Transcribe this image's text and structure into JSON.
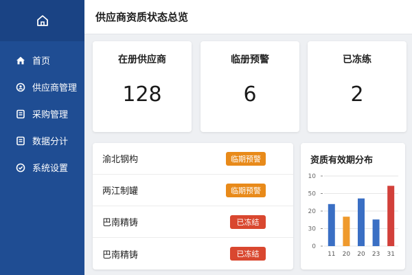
{
  "header": {
    "title": "供应商资质状态总览"
  },
  "sidebar": {
    "logo_icon": "home-outline-icon",
    "items": [
      {
        "label": "首页",
        "icon": "home-icon"
      },
      {
        "label": "供应商管理",
        "icon": "supplier-icon"
      },
      {
        "label": "采购管理",
        "icon": "purchase-list-icon"
      },
      {
        "label": "数据分计",
        "icon": "data-list-icon"
      },
      {
        "label": "系统设置",
        "icon": "settings-icon"
      }
    ]
  },
  "stats": [
    {
      "label": "在册供应商",
      "value": "128"
    },
    {
      "label": "临册预警",
      "value": "6"
    },
    {
      "label": "已冻练",
      "value": "2"
    }
  ],
  "suppliers": [
    {
      "name": "渝北钢构",
      "status": "临期预警",
      "color": "#e88a1a"
    },
    {
      "name": "两江制罐",
      "status": "临期预警",
      "color": "#e88a1a"
    },
    {
      "name": "巴南精铸",
      "status": "已冻结",
      "color": "#d9472f"
    },
    {
      "name": "巴南精铸",
      "status": "已冻结",
      "color": "#d9472f"
    }
  ],
  "colors": {
    "sidebar": "#1f4d93",
    "blue": "#3a6fc4",
    "orange": "#ef9a2d",
    "red": "#d2403a"
  },
  "chart_data": {
    "type": "bar",
    "title": "资质有效期分布",
    "categories": [
      "11",
      "20",
      "20",
      "23",
      "31"
    ],
    "values": [
      30,
      21,
      34,
      19,
      43
    ],
    "colors": [
      "#3a6fc4",
      "#ef9a2d",
      "#3a6fc4",
      "#3a6fc4",
      "#d2403a"
    ],
    "yticks": [
      "10",
      "50",
      "20",
      "30",
      "0"
    ],
    "ylim": [
      0,
      50
    ]
  }
}
